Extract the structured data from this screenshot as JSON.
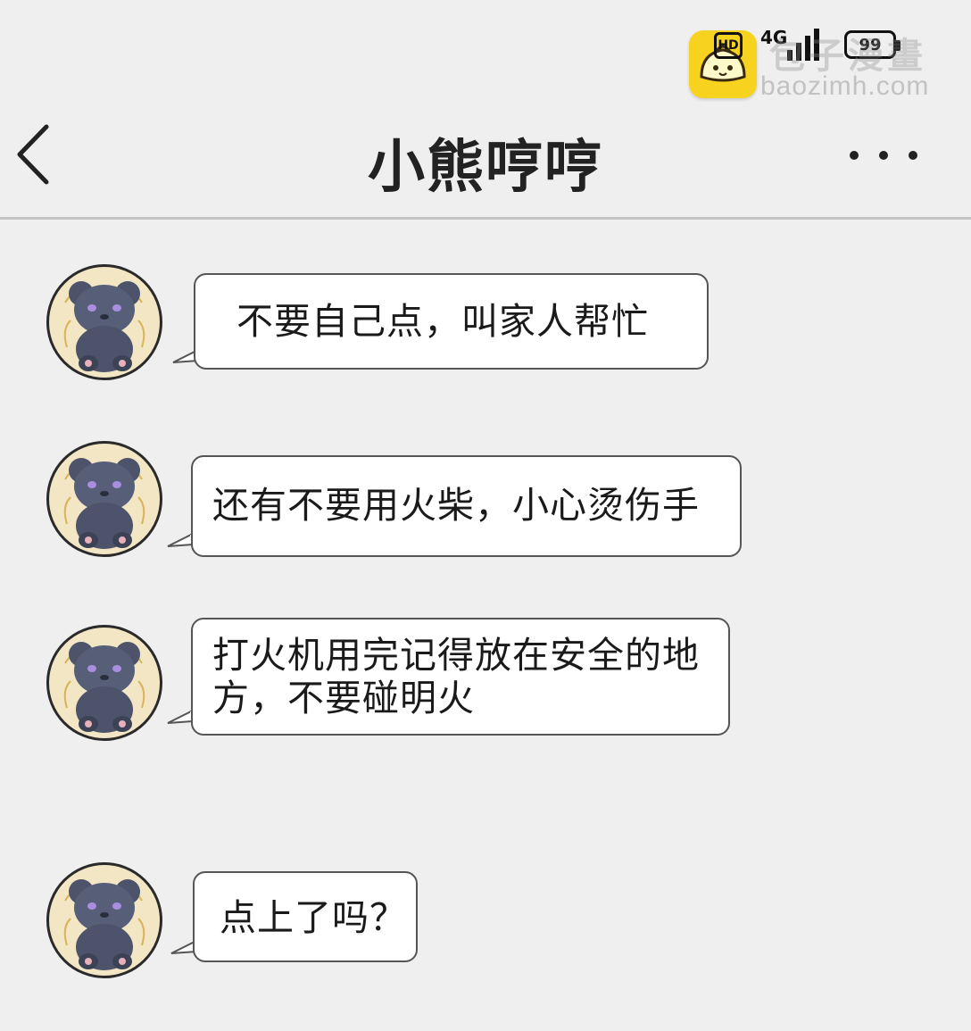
{
  "status_bar": {
    "hd_label": "HD",
    "network_label": "4G",
    "battery_level": "99"
  },
  "watermark": {
    "title": "包子漫畫",
    "domain": "baozimh.com"
  },
  "header": {
    "title": "小熊哼哼",
    "back_icon": "chevron-left-icon",
    "more_icon": "more-horizontal-icon"
  },
  "messages": [
    {
      "sender": "incoming",
      "text": "不要自己点，叫家人帮忙"
    },
    {
      "sender": "incoming",
      "text": "还有不要用火柴，小心烫伤手"
    },
    {
      "sender": "incoming",
      "text": "打火机用完记得放在安全的地方，不要碰明火"
    },
    {
      "sender": "incoming",
      "text": "点上了吗？"
    }
  ],
  "colors": {
    "background": "#efefef",
    "bubble": "#ffffff",
    "divider": "#c4c4c4",
    "watermark_logo": "#f7d21e"
  }
}
